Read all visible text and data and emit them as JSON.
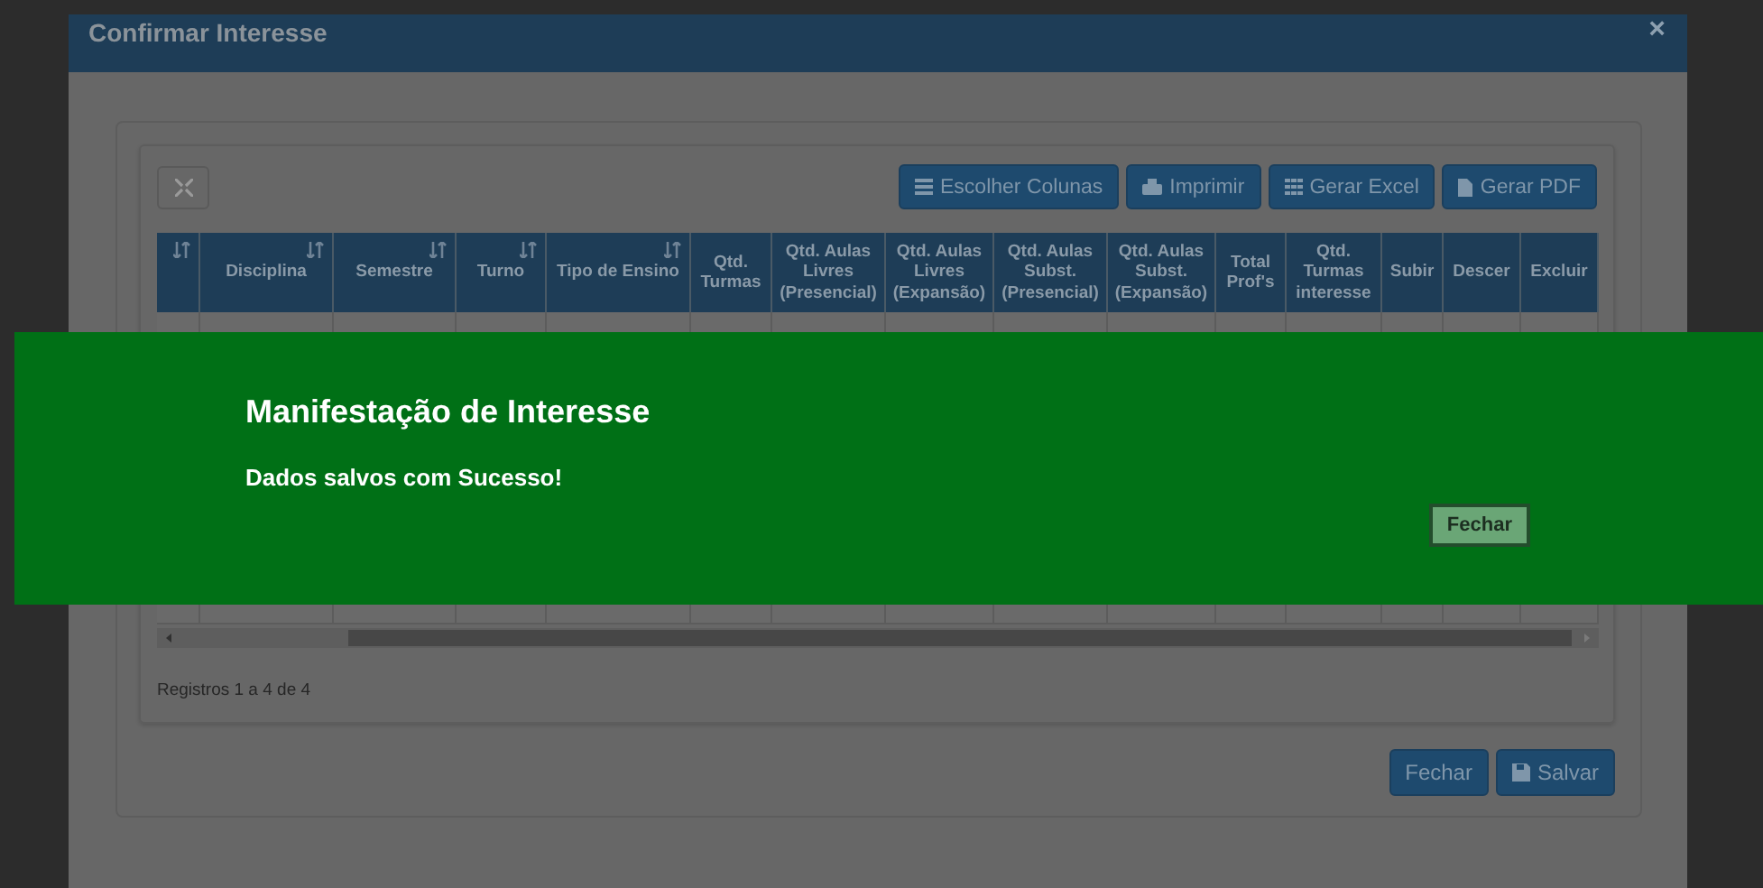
{
  "modal": {
    "title": "Confirmar Interesse",
    "close": "×"
  },
  "toolbar": {
    "buttons": [
      {
        "label": "Escolher Colunas",
        "kind": "columns"
      },
      {
        "label": "Imprimir",
        "kind": "print"
      },
      {
        "label": "Gerar Excel",
        "kind": "excel"
      },
      {
        "label": "Gerar PDF",
        "kind": "pdf"
      }
    ]
  },
  "table": {
    "columns": [
      {
        "sortable": true
      },
      {
        "label": "Disciplina",
        "sortable": true
      },
      {
        "label": "Semestre",
        "sortable": true
      },
      {
        "label": "Turno",
        "sortable": true
      },
      {
        "label": "Tipo de Ensino",
        "sortable": true
      },
      {
        "label": "Qtd. Turmas",
        "sortable": false
      },
      {
        "label": "Qtd. Aulas Livres (Presencial)",
        "sortable": false
      },
      {
        "label": "Qtd. Aulas Livres (Expansão)",
        "sortable": false
      },
      {
        "label": "Qtd. Aulas Subst. (Presencial)",
        "sortable": false
      },
      {
        "label": "Qtd. Aulas Subst. (Expansão)",
        "sortable": false
      },
      {
        "label": "Total Prof's",
        "sortable": false
      },
      {
        "label": "Qtd. Turmas interesse",
        "sortable": false
      },
      {
        "label": "Subir",
        "sortable": false
      },
      {
        "label": "Descer",
        "sortable": false
      },
      {
        "label": "Excluir",
        "sortable": false
      }
    ],
    "footer": "Registros 1 a 4 de 4"
  },
  "footer_buttons": [
    {
      "label": "Fechar",
      "kind": "plain"
    },
    {
      "label": "Salvar",
      "kind": "save"
    }
  ],
  "alert": {
    "title": "Manifestação de Interesse",
    "message": "Dados salvos com Sucesso!",
    "button": "Fechar"
  }
}
